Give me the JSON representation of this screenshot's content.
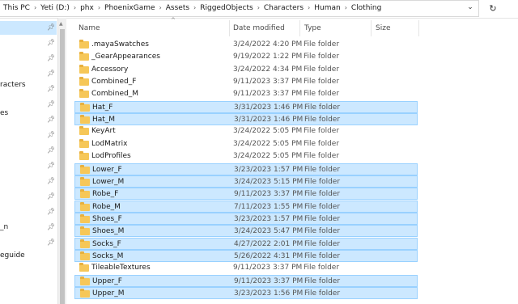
{
  "address_bar": {
    "crumbs": [
      "This PC",
      "Yeti (D:)",
      "phx",
      "PhoenixGame",
      "Assets",
      "RiggedObjects",
      "Characters",
      "Human",
      "Clothing"
    ]
  },
  "sidebar": {
    "items": [
      "racters",
      "es",
      "n_",
      "eguide"
    ]
  },
  "columns": {
    "name": "Name",
    "date": "Date modified",
    "type": "Type",
    "size": "Size"
  },
  "files": [
    {
      "name": ".mayaSwatches",
      "date": "3/24/2022 4:20 PM",
      "type": "File folder",
      "selected": false
    },
    {
      "name": "_GearAppearances",
      "date": "9/19/2022 1:22 PM",
      "type": "File folder",
      "selected": false
    },
    {
      "name": "Accessory",
      "date": "3/24/2022 4:34 PM",
      "type": "File folder",
      "selected": false
    },
    {
      "name": "Combined_F",
      "date": "9/11/2023 3:37 PM",
      "type": "File folder",
      "selected": false
    },
    {
      "name": "Combined_M",
      "date": "9/11/2023 3:37 PM",
      "type": "File folder",
      "selected": false
    },
    {
      "name": "Hat_F",
      "date": "3/31/2023 1:46 PM",
      "type": "File folder",
      "selected": true
    },
    {
      "name": "Hat_M",
      "date": "3/31/2023 1:46 PM",
      "type": "File folder",
      "selected": true
    },
    {
      "name": "KeyArt",
      "date": "3/24/2022 5:05 PM",
      "type": "File folder",
      "selected": false
    },
    {
      "name": "LodMatrix",
      "date": "3/24/2022 5:05 PM",
      "type": "File folder",
      "selected": false
    },
    {
      "name": "LodProfiles",
      "date": "3/24/2022 5:05 PM",
      "type": "File folder",
      "selected": false
    },
    {
      "name": "Lower_F",
      "date": "3/23/2023 1:57 PM",
      "type": "File folder",
      "selected": true
    },
    {
      "name": "Lower_M",
      "date": "3/24/2023 5:15 PM",
      "type": "File folder",
      "selected": true
    },
    {
      "name": "Robe_F",
      "date": "9/11/2023 3:37 PM",
      "type": "File folder",
      "selected": true
    },
    {
      "name": "Robe_M",
      "date": "7/11/2023 1:55 PM",
      "type": "File folder",
      "selected": true
    },
    {
      "name": "Shoes_F",
      "date": "3/23/2023 1:57 PM",
      "type": "File folder",
      "selected": true
    },
    {
      "name": "Shoes_M",
      "date": "3/24/2023 5:47 PM",
      "type": "File folder",
      "selected": true
    },
    {
      "name": "Socks_F",
      "date": "4/27/2022 2:01 PM",
      "type": "File folder",
      "selected": true
    },
    {
      "name": "Socks_M",
      "date": "5/26/2022 4:31 PM",
      "type": "File folder",
      "selected": true
    },
    {
      "name": "TileableTextures",
      "date": "9/11/2023 3:37 PM",
      "type": "File folder",
      "selected": false
    },
    {
      "name": "Upper_F",
      "date": "9/11/2023 3:37 PM",
      "type": "File folder",
      "selected": true
    },
    {
      "name": "Upper_M",
      "date": "3/23/2023 1:56 PM",
      "type": "File folder",
      "selected": true
    }
  ],
  "colors": {
    "selection": "#cce8ff",
    "selection_border": "#99d1ff",
    "folder": "#f6c758"
  }
}
